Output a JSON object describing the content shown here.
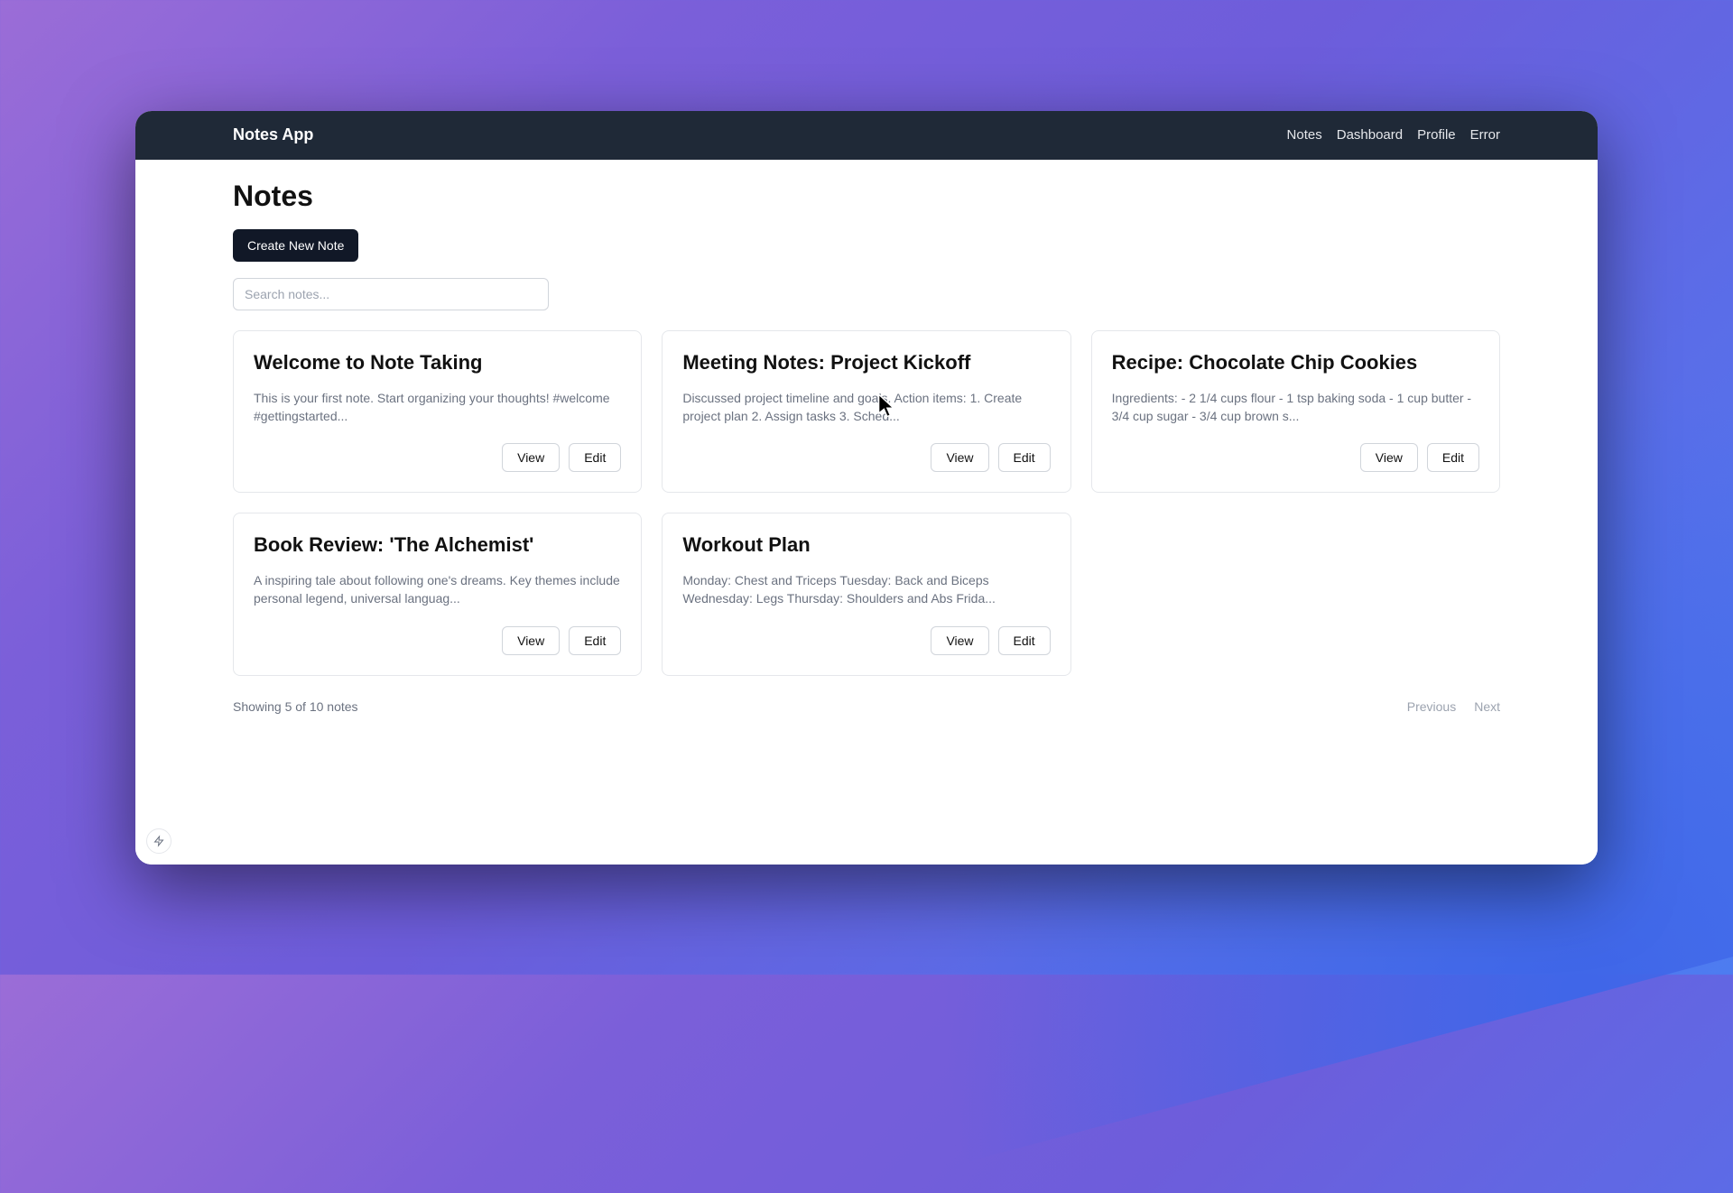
{
  "navbar": {
    "brand": "Notes App",
    "links": [
      "Notes",
      "Dashboard",
      "Profile",
      "Error"
    ]
  },
  "page": {
    "title": "Notes",
    "create_label": "Create New Note",
    "search_placeholder": "Search notes..."
  },
  "notes": [
    {
      "title": "Welcome to Note Taking",
      "excerpt": "This is your first note. Start organizing your thoughts! #welcome #gettingstarted..."
    },
    {
      "title": "Meeting Notes: Project Kickoff",
      "excerpt": "Discussed project timeline and goals. Action items: 1. Create project plan 2. Assign tasks 3. Sched..."
    },
    {
      "title": "Recipe: Chocolate Chip Cookies",
      "excerpt": "Ingredients: - 2 1/4 cups flour - 1 tsp baking soda - 1 cup butter - 3/4 cup sugar - 3/4 cup brown s..."
    },
    {
      "title": "Book Review: 'The Alchemist'",
      "excerpt": "A inspiring tale about following one's dreams. Key themes include personal legend, universal languag..."
    },
    {
      "title": "Workout Plan",
      "excerpt": "Monday: Chest and Triceps Tuesday: Back and Biceps Wednesday: Legs Thursday: Shoulders and Abs Frida..."
    }
  ],
  "card_actions": {
    "view": "View",
    "edit": "Edit"
  },
  "pagination": {
    "showing": "Showing 5 of 10 notes",
    "previous": "Previous",
    "next": "Next"
  },
  "bolt_glyph": "⚡"
}
